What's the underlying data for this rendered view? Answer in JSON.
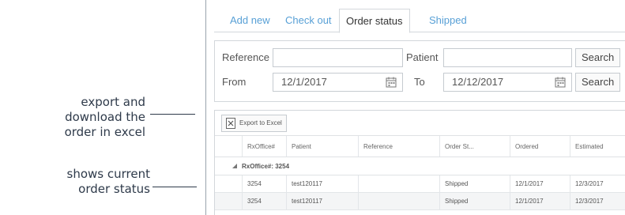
{
  "annotations": {
    "export_note": "export and download the order in excel",
    "status_note": "shows current order status"
  },
  "tabs": [
    {
      "label": "Add new",
      "active": false
    },
    {
      "label": "Check out",
      "active": false
    },
    {
      "label": "Order status",
      "active": true
    },
    {
      "label": "Shipped",
      "active": false
    }
  ],
  "form": {
    "reference_label": "Reference",
    "reference_value": "",
    "patient_label": "Patient",
    "patient_value": "",
    "search_label": "Search",
    "from_label": "From",
    "from_value": "12/1/2017",
    "to_label": "To",
    "to_value": "12/12/2017",
    "search2_label": "Search"
  },
  "grid": {
    "export_label": "Export to Excel",
    "columns": [
      "RxOffice#",
      "Patient",
      "Reference",
      "Order St...",
      "Ordered",
      "Estimated"
    ],
    "group_label": "RxOffice#: 3254",
    "rows": [
      [
        "3254",
        "test120117",
        "",
        "Shipped",
        "12/1/2017",
        "12/3/2017"
      ],
      [
        "3254",
        "test120117",
        "",
        "Shipped",
        "12/1/2017",
        "12/3/2017"
      ]
    ]
  },
  "colors": {
    "tab_link": "#58a0d6",
    "border": "#d3d7db",
    "annotation_text": "#2e3a4a"
  }
}
